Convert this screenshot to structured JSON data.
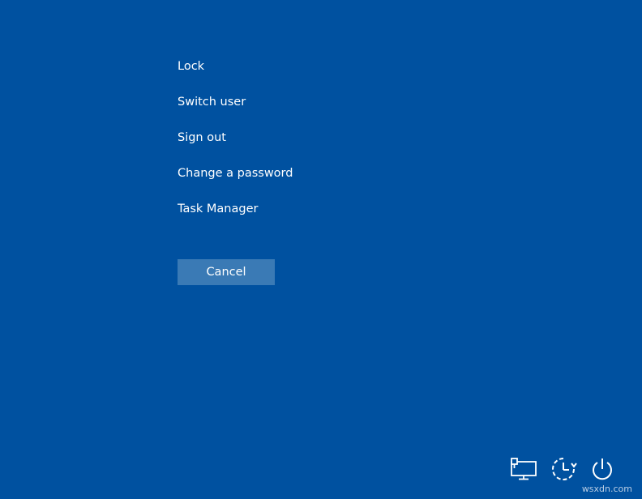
{
  "menu": {
    "items": [
      {
        "label": "Lock"
      },
      {
        "label": "Switch user"
      },
      {
        "label": "Sign out"
      },
      {
        "label": "Change a password"
      },
      {
        "label": "Task Manager"
      }
    ]
  },
  "cancel": {
    "label": "Cancel"
  },
  "tray": {
    "icons": [
      "network-icon",
      "ease-of-access-icon",
      "power-icon"
    ]
  },
  "watermark": {
    "text": "wsxdn.com"
  },
  "colors": {
    "background": "#0051a0",
    "cancel_button": "#3a7ab5",
    "text": "#ffffff"
  }
}
